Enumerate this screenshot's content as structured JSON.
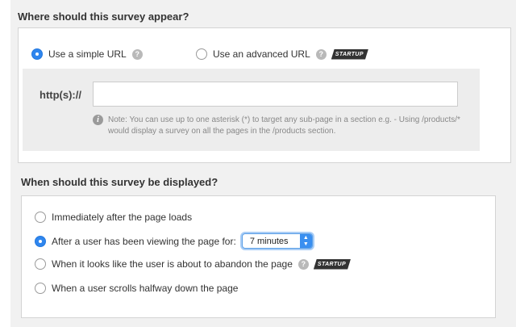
{
  "where_section": {
    "title": "Where should this survey appear?",
    "url_options": [
      {
        "label": "Use a simple URL",
        "checked": true,
        "help": "?"
      },
      {
        "label": "Use an advanced URL",
        "checked": false,
        "help": "?",
        "badge": "STARTUP"
      }
    ],
    "url": {
      "prefix": "http(s)://",
      "value": "",
      "placeholder": ""
    },
    "note": {
      "icon": "i",
      "text": "Note: You can use up to one asterisk (*) to target any sub-page in a section e.g. - Using /products/* would display a survey on all the pages in the /products section."
    }
  },
  "when_section": {
    "title": "When should this survey be displayed?",
    "options": [
      {
        "label": "Immediately after the page loads",
        "checked": false
      },
      {
        "label": "After a user has been viewing the page for:",
        "checked": true,
        "select_value": "7 minutes"
      },
      {
        "label": "When it looks like the user is about to abandon the page",
        "checked": false,
        "help": "?",
        "badge": "STARTUP"
      },
      {
        "label": "When a user scrolls halfway down the page",
        "checked": false
      }
    ]
  },
  "icons": {
    "help": "question-circle-icon",
    "info": "info-circle-icon",
    "select_arrows": "up-down-chevron-icon"
  },
  "colors": {
    "radio_selected": "#2f86ee",
    "badge_bg": "#333333",
    "section_bg": "#f1f1f1",
    "url_box_bg": "#ededed",
    "select_button": "#3a8ff0",
    "help_icon": "#b9b9b9"
  }
}
